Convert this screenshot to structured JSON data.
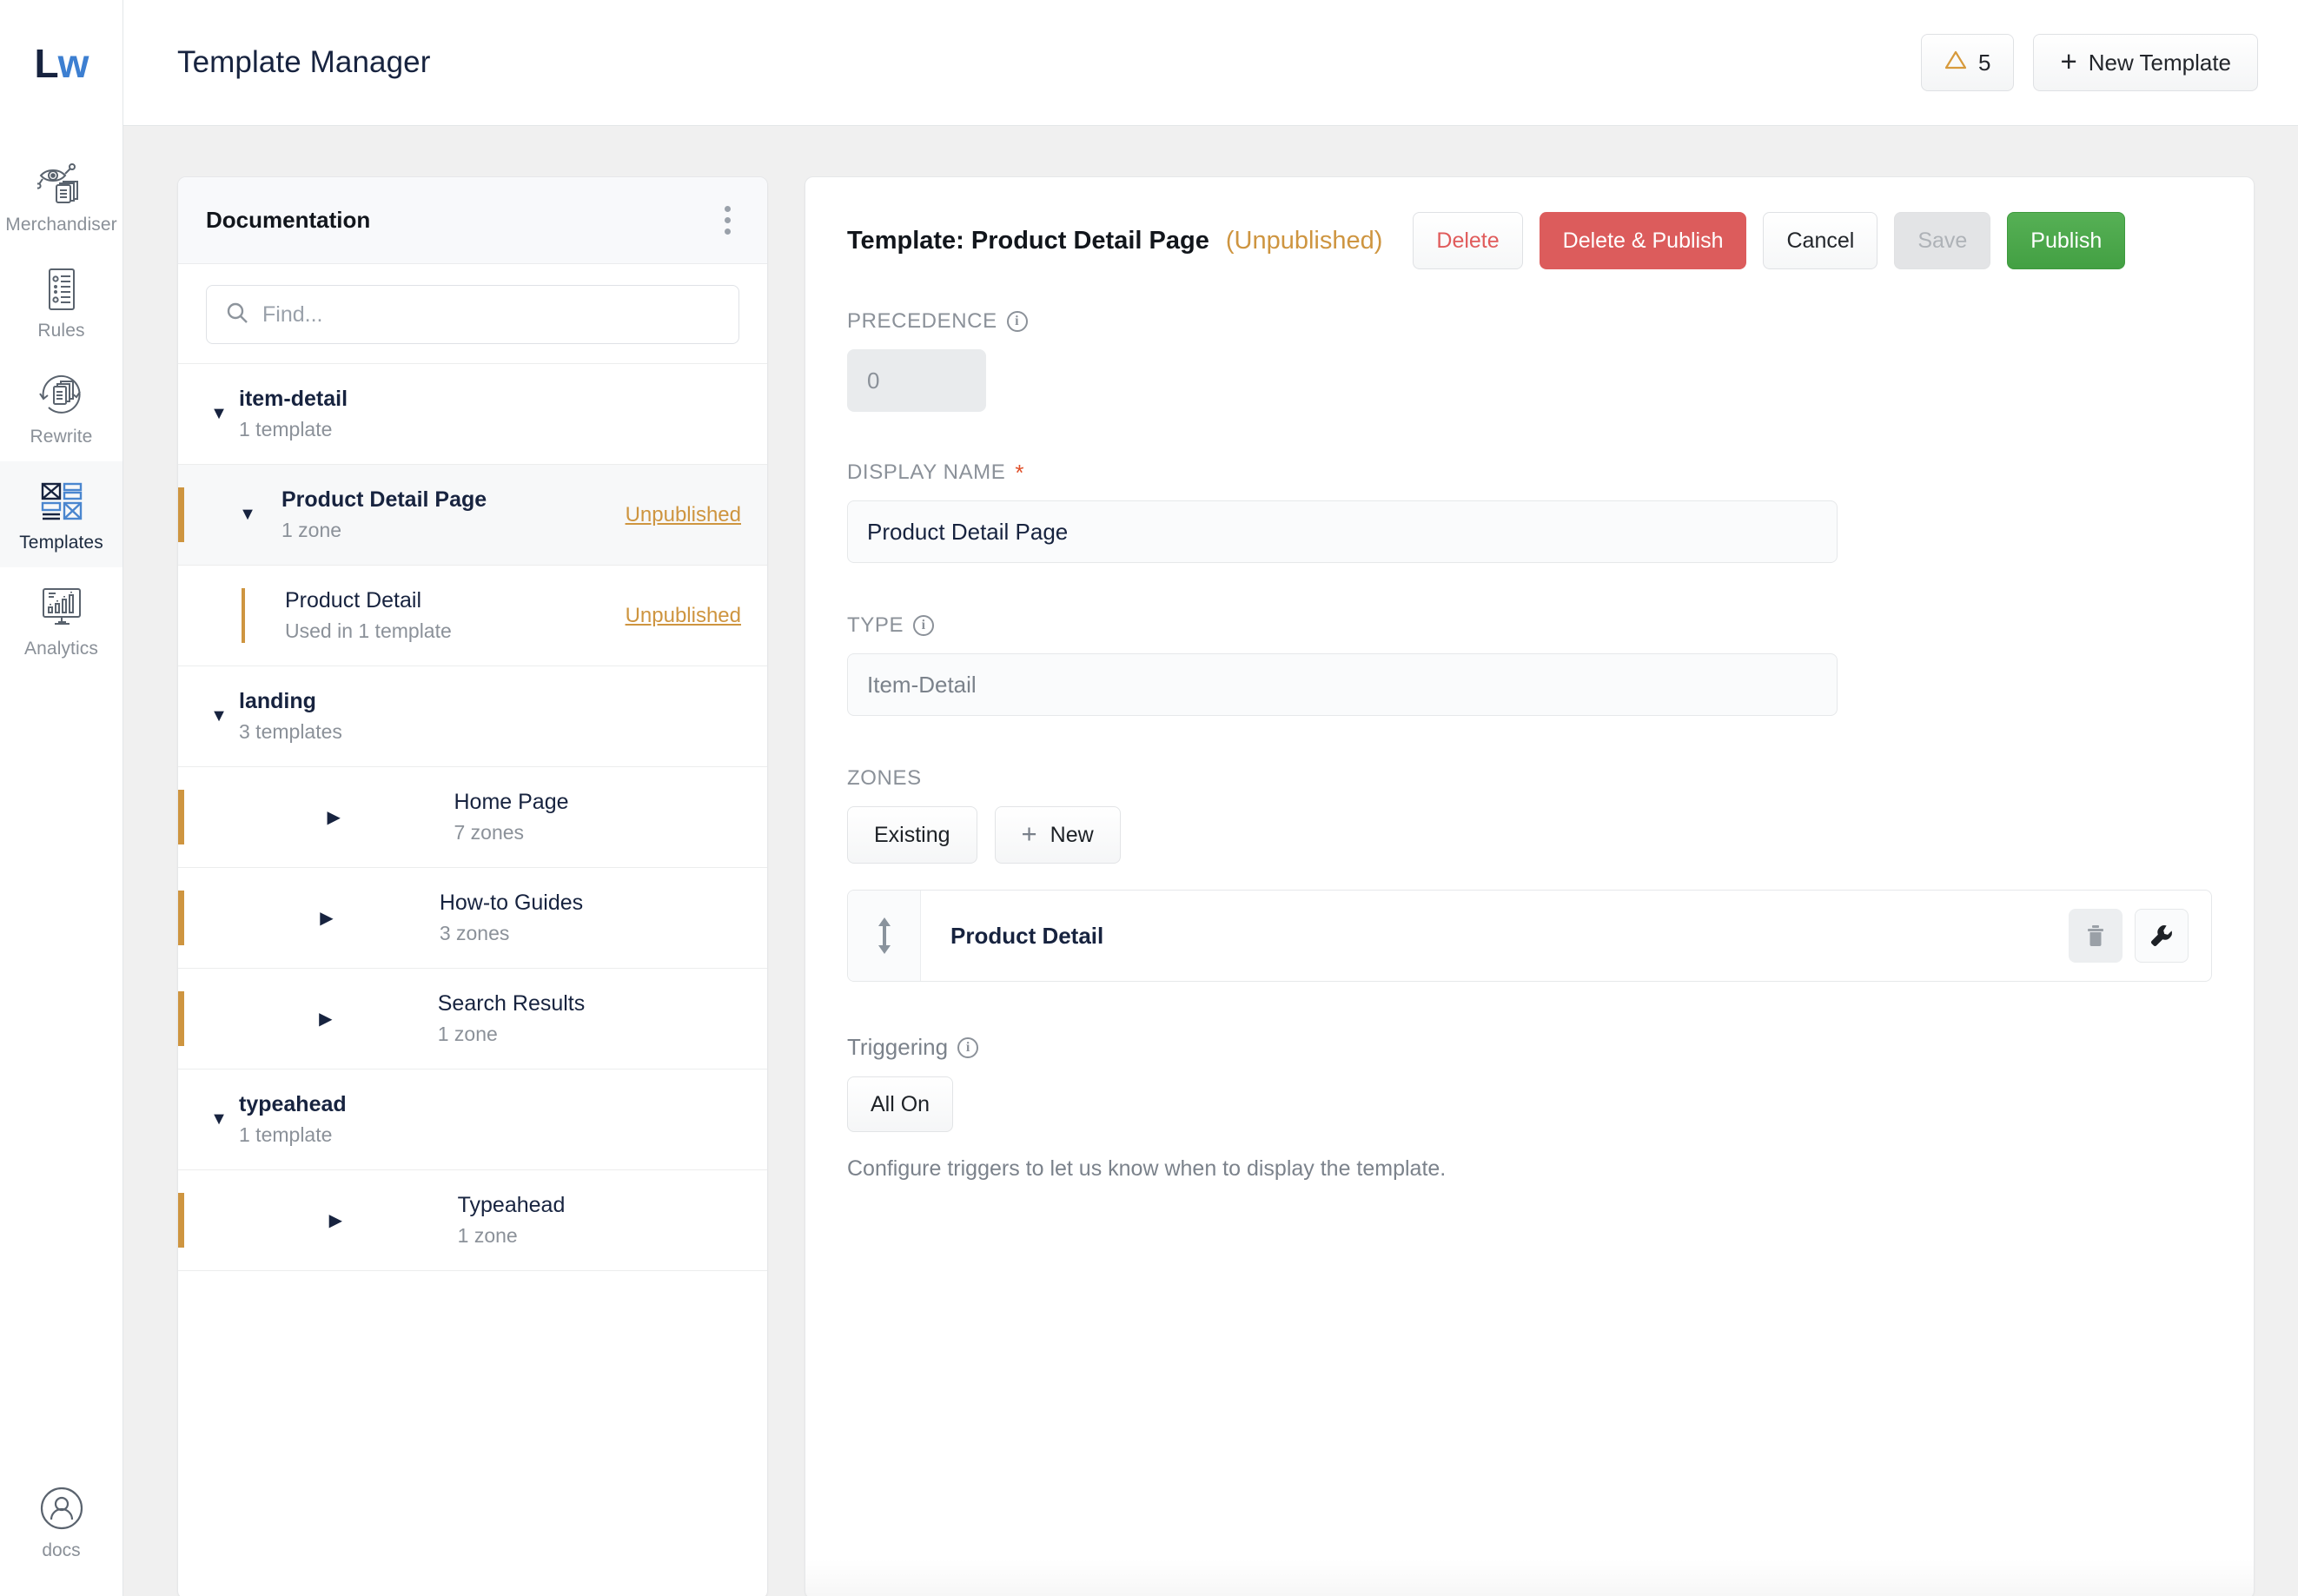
{
  "brand": {
    "logo_left": "L",
    "logo_right": "w"
  },
  "rail": {
    "items": [
      {
        "label": "Merchandiser",
        "icon": "merchandiser-icon",
        "active": false
      },
      {
        "label": "Rules",
        "icon": "rules-icon",
        "active": false
      },
      {
        "label": "Rewrite",
        "icon": "rewrite-icon",
        "active": false
      },
      {
        "label": "Templates",
        "icon": "templates-icon",
        "active": true
      },
      {
        "label": "Analytics",
        "icon": "analytics-icon",
        "active": false
      }
    ],
    "bottom": {
      "label": "docs",
      "icon": "user-circle-icon"
    }
  },
  "header": {
    "title": "Template Manager",
    "alert_count": "5",
    "alert_icon": "warning-triangle-icon",
    "new_template_label": "New Template",
    "new_template_icon": "plus-icon"
  },
  "tree": {
    "title": "Documentation",
    "kebab_icon": "more-vertical-icon",
    "search_placeholder": "Find...",
    "search_value": "",
    "search_icon": "search-icon",
    "groups": [
      {
        "name": "item-detail",
        "sub": "1 template",
        "expanded": true,
        "items": [
          {
            "name": "Product Detail Page",
            "sub": "1 zone",
            "status": "Unpublished",
            "selected": true,
            "expanded": true,
            "depth": 1,
            "accent": true
          },
          {
            "name": "Product Detail",
            "sub": "Used in 1 template",
            "status": "Unpublished",
            "selected": false,
            "expanded": null,
            "depth": 2,
            "accent": false
          }
        ]
      },
      {
        "name": "landing",
        "sub": "3 templates",
        "expanded": true,
        "items": [
          {
            "name": "Home Page",
            "sub": "7 zones",
            "status": "",
            "selected": false,
            "expanded": false,
            "depth": 1,
            "accent": true
          },
          {
            "name": "How-to Guides",
            "sub": "3 zones",
            "status": "",
            "selected": false,
            "expanded": false,
            "depth": 1,
            "accent": true
          },
          {
            "name": "Search Results",
            "sub": "1 zone",
            "status": "",
            "selected": false,
            "expanded": false,
            "depth": 1,
            "accent": true
          }
        ]
      },
      {
        "name": "typeahead",
        "sub": "1 template",
        "expanded": true,
        "items": [
          {
            "name": "Typeahead",
            "sub": "1 zone",
            "status": "",
            "selected": false,
            "expanded": false,
            "depth": 1,
            "accent": true
          }
        ]
      }
    ]
  },
  "detail": {
    "title": "Template: Product Detail Page",
    "status": "(Unpublished)",
    "buttons": {
      "delete": "Delete",
      "delete_publish": "Delete & Publish",
      "cancel": "Cancel",
      "save": "Save",
      "publish": "Publish"
    },
    "precedence": {
      "label": "PRECEDENCE",
      "value": "0",
      "info_icon": "info-icon"
    },
    "display_name": {
      "label": "DISPLAY NAME",
      "value": "Product Detail Page",
      "required": "*"
    },
    "type": {
      "label": "TYPE",
      "value": "Item-Detail",
      "info_icon": "info-icon"
    },
    "zones": {
      "label": "ZONES",
      "existing_label": "Existing",
      "new_label": "New",
      "new_icon": "plus-icon",
      "rows": [
        {
          "name": "Product Detail",
          "drag_icon": "drag-vertical-icon",
          "delete_icon": "trash-icon",
          "config_icon": "wrench-icon"
        }
      ]
    },
    "triggering": {
      "label": "Triggering",
      "info_icon": "info-icon",
      "all_on_label": "All On",
      "help": "Configure triggers to let us know when to display the template."
    }
  },
  "colors": {
    "accent_orange": "#ce9540",
    "publish_green": "#43a043",
    "danger_red": "#dc5c5c",
    "brand_blue": "#3d7fd1",
    "navy": "#17233f"
  }
}
